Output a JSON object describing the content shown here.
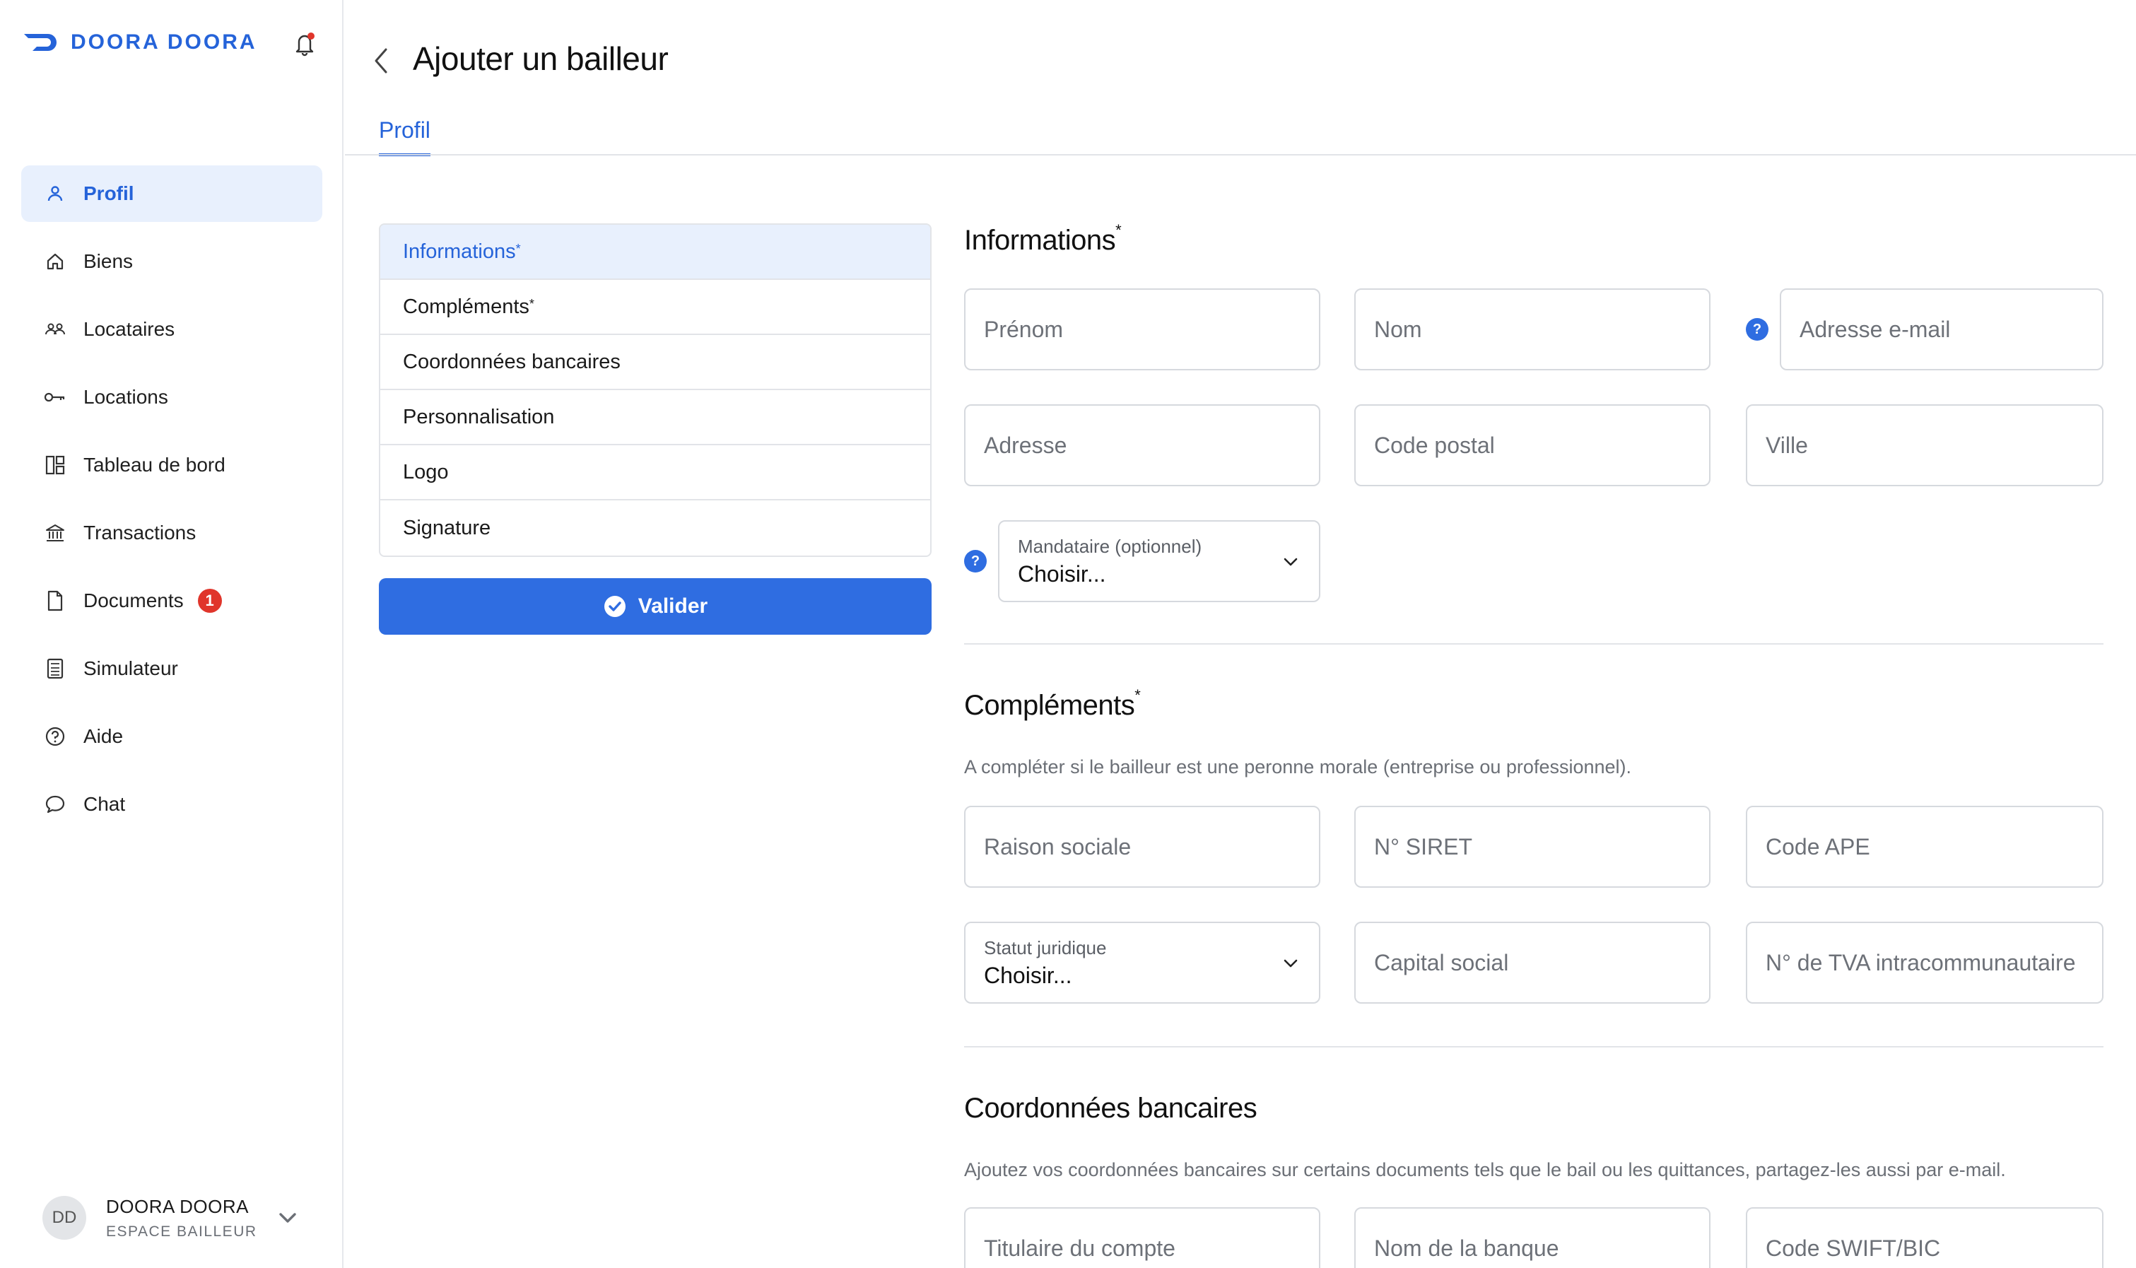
{
  "brand": {
    "name": "DOORA DOORA"
  },
  "sidebar": {
    "items": [
      {
        "label": "Profil",
        "icon": "user-icon",
        "active": true
      },
      {
        "label": "Biens",
        "icon": "home-icon"
      },
      {
        "label": "Locataires",
        "icon": "users-icon"
      },
      {
        "label": "Locations",
        "icon": "key-icon"
      },
      {
        "label": "Tableau de bord",
        "icon": "dashboard-icon"
      },
      {
        "label": "Transactions",
        "icon": "bank-icon"
      },
      {
        "label": "Documents",
        "icon": "document-icon",
        "badge": "1"
      },
      {
        "label": "Simulateur",
        "icon": "calculator-icon"
      },
      {
        "label": "Aide",
        "icon": "help-circle-icon"
      },
      {
        "label": "Chat",
        "icon": "chat-bubble-icon"
      }
    ],
    "user": {
      "initials": "DD",
      "name": "DOORA DOORA",
      "role": "ESPACE BAILLEUR"
    }
  },
  "header": {
    "title": "Ajouter un bailleur",
    "tab": "Profil"
  },
  "sections_nav": {
    "items": [
      {
        "label": "Informations",
        "required": "*",
        "active": true
      },
      {
        "label": "Compléments",
        "required": "*"
      },
      {
        "label": "Coordonnées bancaires",
        "required": ""
      },
      {
        "label": "Personnalisation",
        "required": ""
      },
      {
        "label": "Logo",
        "required": ""
      },
      {
        "label": "Signature",
        "required": ""
      }
    ],
    "submit_label": "Valider"
  },
  "informations": {
    "title": "Informations",
    "required": "*",
    "firstname_placeholder": "Prénom",
    "lastname_placeholder": "Nom",
    "email_placeholder": "Adresse e-mail",
    "address_placeholder": "Adresse",
    "postal_placeholder": "Code postal",
    "city_placeholder": "Ville",
    "mandataire_label": "Mandataire (optionnel)",
    "mandataire_value": "Choisir...",
    "help_glyph": "?"
  },
  "complements": {
    "title": "Compléments",
    "required": "*",
    "description": "A compléter si le bailleur est une peronne morale (entreprise ou professionnel).",
    "raison_placeholder": "Raison sociale",
    "siret_placeholder": "N° SIRET",
    "ape_placeholder": "Code APE",
    "statut_label": "Statut juridique",
    "statut_value": "Choisir...",
    "capital_placeholder": "Capital social",
    "tva_placeholder": "N° de TVA intracommunautaire"
  },
  "bancaires": {
    "title": "Coordonnées bancaires",
    "description": "Ajoutez vos coordonnées bancaires sur certains documents tels que le bail ou les quittances, partagez-les aussi par e-mail.",
    "titulaire_placeholder": "Titulaire du compte",
    "banque_placeholder": "Nom de la banque",
    "swift_placeholder": "Code SWIFT/BIC"
  },
  "colors": {
    "accent": "#2563d9",
    "button": "#2f6de1",
    "badge": "#e0352b",
    "active_bg": "#e8f0fd"
  }
}
